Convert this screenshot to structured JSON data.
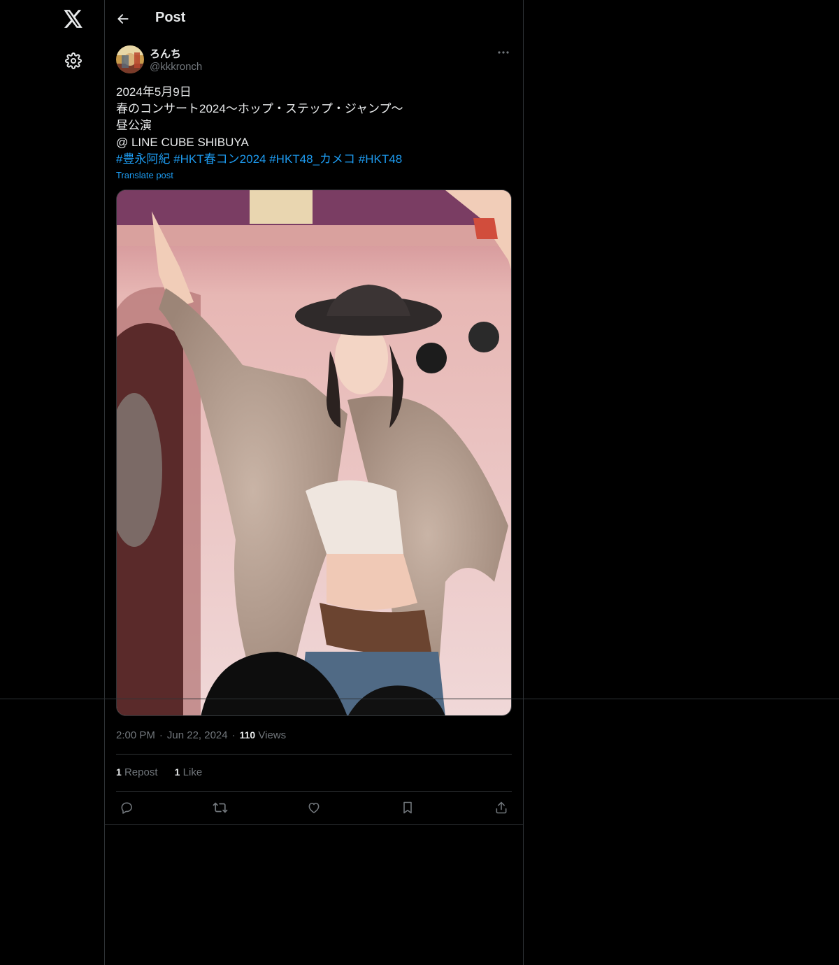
{
  "nav": {
    "logo_icon": "x-logo-icon",
    "settings_icon": "gear-icon"
  },
  "header": {
    "title": "Post",
    "back_icon": "arrow-left-icon"
  },
  "post": {
    "author": {
      "display_name": "ろんち",
      "handle": "@kkkronch"
    },
    "text_lines": [
      "2024年5月9日",
      "春のコンサート2024〜ホップ・ステップ・ジャンプ〜",
      "昼公演",
      "@ LINE CUBE SHIBUYA"
    ],
    "hashtags": [
      "#豊永阿紀",
      "#HKT春コン2024",
      "#HKT48_カメコ",
      "#HKT48"
    ],
    "translate_label": "Translate post",
    "time": "2:00 PM",
    "date": "Jun 22, 2024",
    "views_count": "110",
    "views_label": "Views",
    "reposts_count": "1",
    "reposts_label": "Repost",
    "likes_count": "1",
    "likes_label": "Like"
  },
  "colors": {
    "background": "#000000",
    "accent": "#1d9bf0",
    "text_primary": "#e7e9ea",
    "text_secondary": "#71767b",
    "divider": "#2f3336"
  }
}
